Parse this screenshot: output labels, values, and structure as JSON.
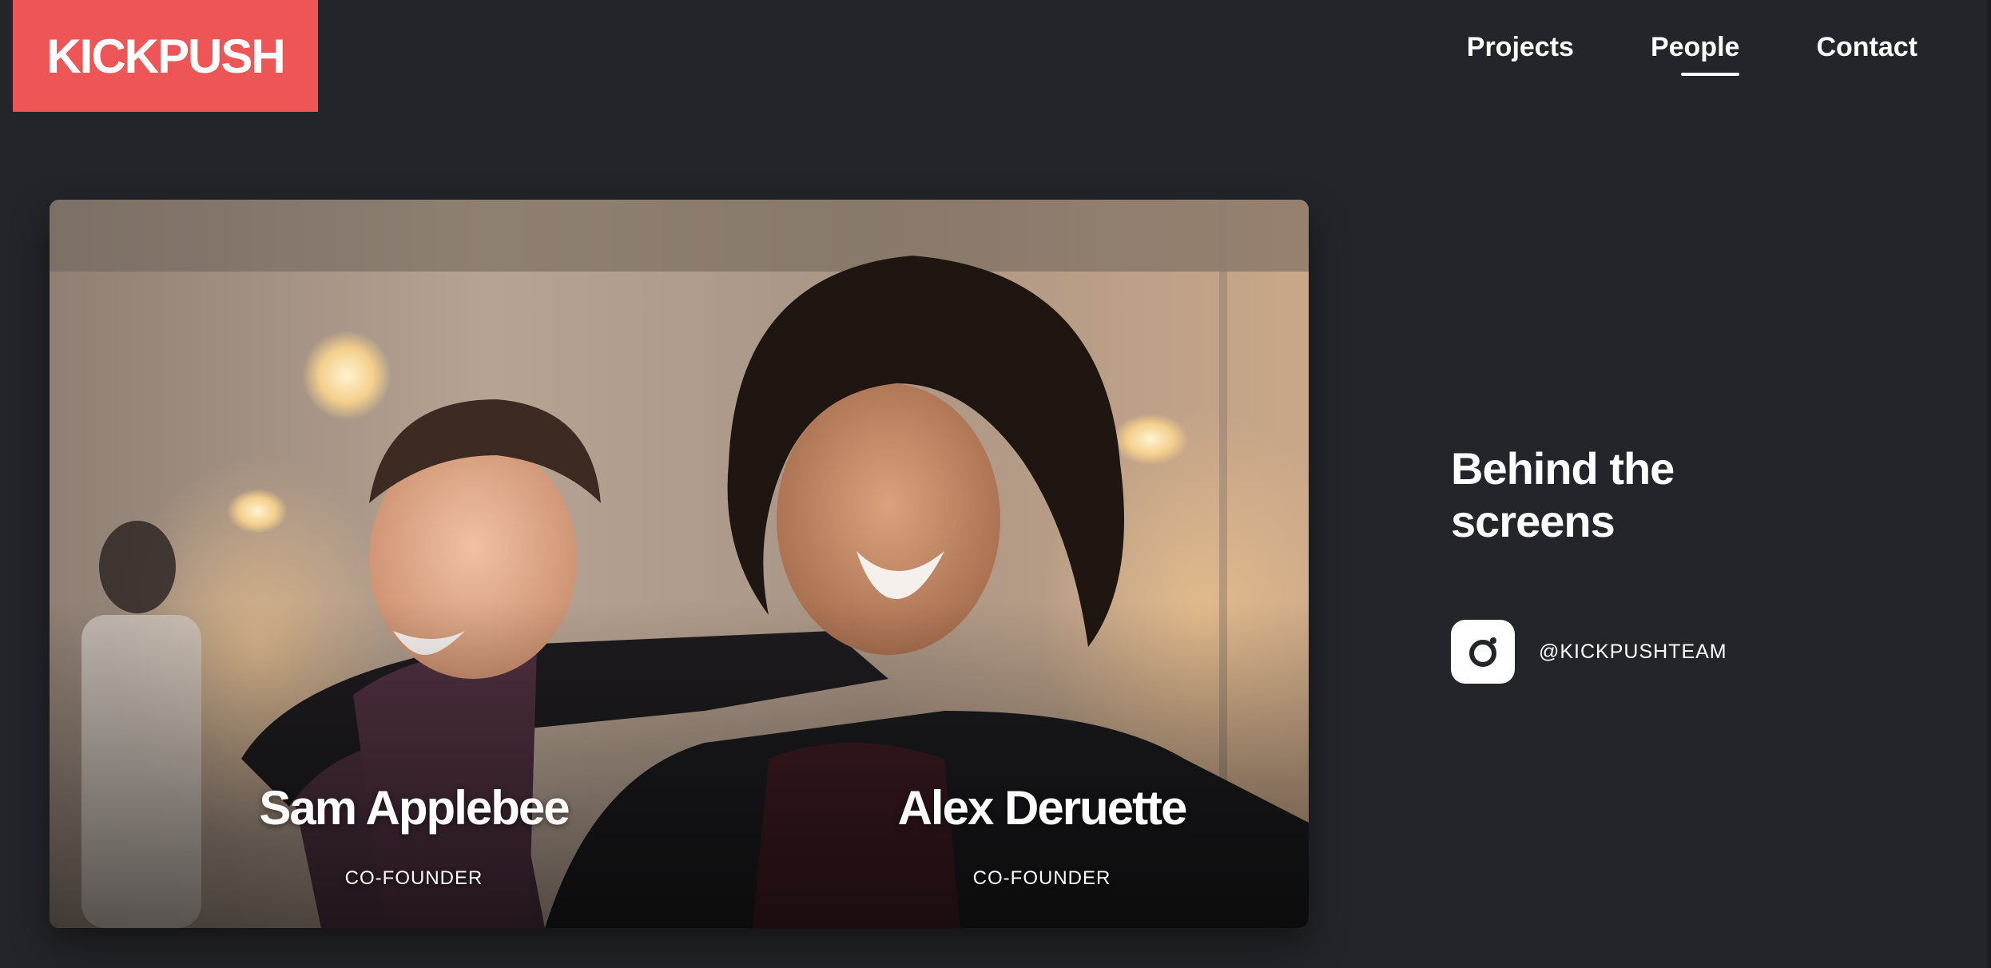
{
  "header": {
    "logo_text": "KICKPUSH",
    "nav": [
      {
        "label": "Projects",
        "active": false
      },
      {
        "label": "People",
        "active": true
      },
      {
        "label": "Contact",
        "active": false
      }
    ]
  },
  "team_photo": {
    "people": [
      {
        "name": "Sam Applebee",
        "role": "CO-FOUNDER"
      },
      {
        "name": "Alex Deruette",
        "role": "CO-FOUNDER"
      }
    ]
  },
  "aside": {
    "title": "Behind the screens",
    "instagram": {
      "icon": "instagram-icon",
      "handle": "@KICKPUSHTEAM"
    }
  },
  "colors": {
    "background": "#24252a",
    "brand": "#ee5557",
    "text": "#ffffff"
  }
}
